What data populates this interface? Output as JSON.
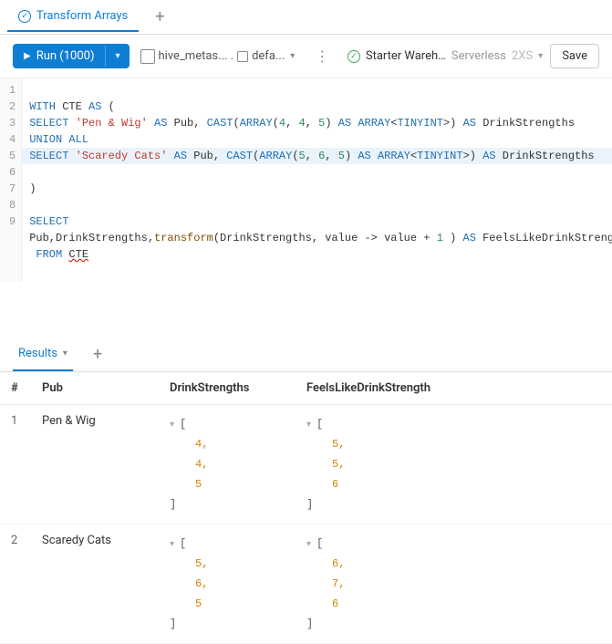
{
  "tab": {
    "title": "Transform Arrays"
  },
  "toolbar": {
    "run_label": "Run (1000)",
    "catalog": "hive_metas... . ",
    "schema": "defa...",
    "kebab": "⋮",
    "warehouse_name": "Starter Wareh...",
    "warehouse_type": "Serverless",
    "warehouse_size": "2XS",
    "save_label": "Save"
  },
  "code": {
    "l1_a": "WITH",
    "l1_b": " CTE ",
    "l1_c": "AS",
    "l1_d": " (",
    "l2_a": "SELECT",
    "l2_b": " ",
    "l2_c": "'Pen & Wig'",
    "l2_d": " ",
    "l2_e": "AS",
    "l2_f": " Pub, ",
    "l2_g": "CAST",
    "l2_h": "(",
    "l2_i": "ARRAY",
    "l2_j": "(",
    "l2_k": "4",
    "l2_l": ", ",
    "l2_m": "4",
    "l2_n": ", ",
    "l2_o": "5",
    "l2_p": ") ",
    "l2_q": "AS",
    "l2_r": " ",
    "l2_s": "ARRAY",
    "l2_t": "<",
    "l2_u": "TINYINT",
    "l2_v": ">) ",
    "l2_w": "AS",
    "l2_x": " DrinkStrengths",
    "l3_a": "UNION ALL",
    "l4_a": "SELECT",
    "l4_b": " ",
    "l4_c": "'Scaredy Cats'",
    "l4_d": " ",
    "l4_e": "AS",
    "l4_f": " Pub, ",
    "l4_g": "CAST",
    "l4_h": "(",
    "l4_i": "ARRAY",
    "l4_j": "(",
    "l4_k": "5",
    "l4_l": ", ",
    "l4_m": "6",
    "l4_n": ", ",
    "l4_o": "5",
    "l4_p": ") ",
    "l4_q": "AS",
    "l4_r": " ",
    "l4_s": "ARRAY",
    "l4_t": "<",
    "l4_u": "TINYINT",
    "l4_v": ">) ",
    "l4_w": "AS",
    "l4_x": " DrinkStrengths",
    "l5": ")",
    "l7": "SELECT",
    "l8_a": "Pub,DrinkStrengths,",
    "l8_b": "transform",
    "l8_c": "(DrinkStrengths, value -> value + ",
    "l8_d": "1",
    "l8_e": " ) ",
    "l8_f": "AS",
    "l8_g": " FeelsLikeDrinkStrength",
    "l9_a": " ",
    "l9_b": "FROM",
    "l9_c": " ",
    "l9_d": "CTE"
  },
  "results": {
    "tab_label": "Results",
    "headers": {
      "idx": "#",
      "c1": "Pub",
      "c2": "DrinkStrengths",
      "c3": "FeelsLikeDrinkStrength"
    },
    "rows": [
      {
        "idx": "1",
        "pub": "Pen & Wig",
        "ds": [
          "4,",
          "4,",
          "5"
        ],
        "fl": [
          "5,",
          "5,",
          "6"
        ]
      },
      {
        "idx": "2",
        "pub": "Scaredy Cats",
        "ds": [
          "5,",
          "6,",
          "5"
        ],
        "fl": [
          "6,",
          "7,",
          "6"
        ]
      }
    ],
    "bracket_open": "[",
    "bracket_close": "]"
  }
}
